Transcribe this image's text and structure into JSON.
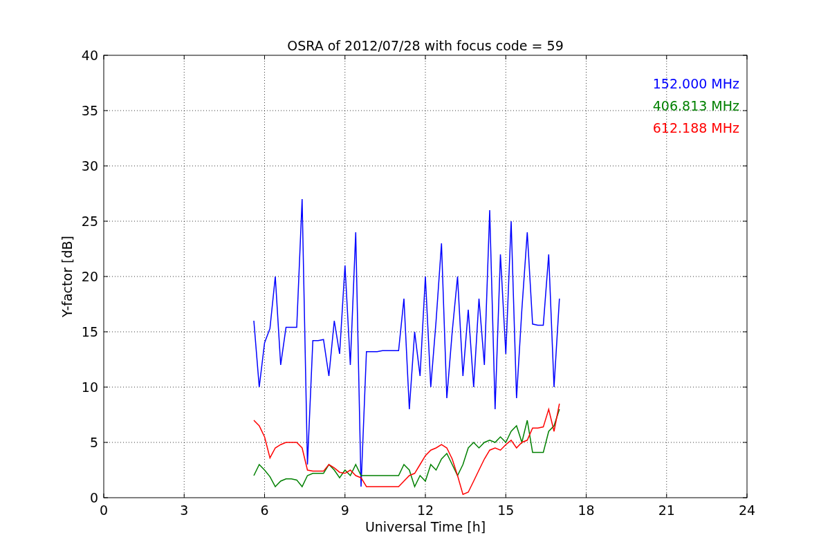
{
  "chart_data": {
    "type": "line",
    "title": "OSRA of 2012/07/28 with focus code = 59",
    "xlabel": "Universal Time [h]",
    "ylabel": "Y-factor [dB]",
    "x": [
      5.6,
      5.8,
      6.0,
      6.2,
      6.4,
      6.6,
      6.8,
      7.0,
      7.2,
      7.4,
      7.6,
      7.8,
      8.0,
      8.2,
      8.4,
      8.6,
      8.8,
      9.0,
      9.2,
      9.4,
      9.6,
      9.8,
      10.0,
      10.2,
      10.4,
      10.6,
      10.8,
      11.0,
      11.2,
      11.4,
      11.6,
      11.8,
      12.0,
      12.2,
      12.4,
      12.6,
      12.8,
      13.0,
      13.2,
      13.4,
      13.6,
      13.8,
      14.0,
      14.2,
      14.4,
      14.6,
      14.8,
      15.0,
      15.2,
      15.4,
      15.6,
      15.8,
      16.0,
      16.2,
      16.4,
      16.6,
      16.8,
      17.0
    ],
    "series": [
      {
        "name": "152.000 MHz",
        "color": "#0000ff",
        "values": [
          16,
          10,
          14,
          15.3,
          20,
          12,
          15.4,
          15.4,
          15.4,
          27,
          3,
          14.2,
          14.2,
          14.3,
          11,
          16,
          13,
          21,
          12,
          24,
          1,
          13.2,
          13.2,
          13.2,
          13.3,
          13.3,
          13.3,
          13.3,
          18,
          8,
          15,
          11,
          20,
          10,
          16,
          23,
          9,
          15,
          20,
          11,
          17,
          10,
          18,
          12,
          26,
          8,
          22,
          13,
          25,
          9,
          17,
          24,
          15.7,
          15.6,
          15.6,
          22,
          10,
          18
        ]
      },
      {
        "name": "406.813 MHz",
        "color": "#008000",
        "values": [
          2,
          3,
          2.5,
          1.9,
          1,
          1.5,
          1.7,
          1.7,
          1.6,
          1,
          2,
          2.2,
          2.2,
          2.2,
          3,
          2.5,
          1.8,
          2.5,
          2,
          3,
          2,
          2,
          2,
          2,
          2,
          2,
          2,
          2,
          3,
          2.5,
          1,
          2,
          1.5,
          3,
          2.5,
          3.5,
          4,
          3,
          2,
          3,
          4.5,
          5,
          4.5,
          5,
          5.2,
          5,
          5.5,
          5,
          6,
          6.5,
          5,
          7,
          4.1,
          4.1,
          4.1,
          6,
          6.5,
          8
        ]
      },
      {
        "name": "612.188 MHz",
        "color": "#ff0000",
        "values": [
          7,
          6.5,
          5.5,
          3.6,
          4.5,
          4.8,
          5,
          5,
          5,
          4.5,
          2.5,
          2.4,
          2.4,
          2.4,
          3,
          2.7,
          2.3,
          2.2,
          2.5,
          2,
          1.8,
          1,
          1,
          1,
          1,
          1,
          1,
          1,
          1.5,
          2,
          2.2,
          3,
          3.8,
          4.3,
          4.5,
          4.8,
          4.5,
          3.5,
          2,
          0.3,
          0.5,
          1.5,
          2.5,
          3.5,
          4.3,
          4.5,
          4.3,
          4.8,
          5.2,
          4.5,
          5,
          5.2,
          6.3,
          6.3,
          6.4,
          8,
          6,
          8.5
        ]
      }
    ],
    "xlim": [
      0,
      24
    ],
    "ylim": [
      0,
      40
    ],
    "grid": true,
    "xticks": [
      0,
      3,
      6,
      9,
      12,
      15,
      18,
      21,
      24
    ],
    "yticks": [
      0,
      5,
      10,
      15,
      20,
      25,
      30,
      35,
      40
    ]
  }
}
